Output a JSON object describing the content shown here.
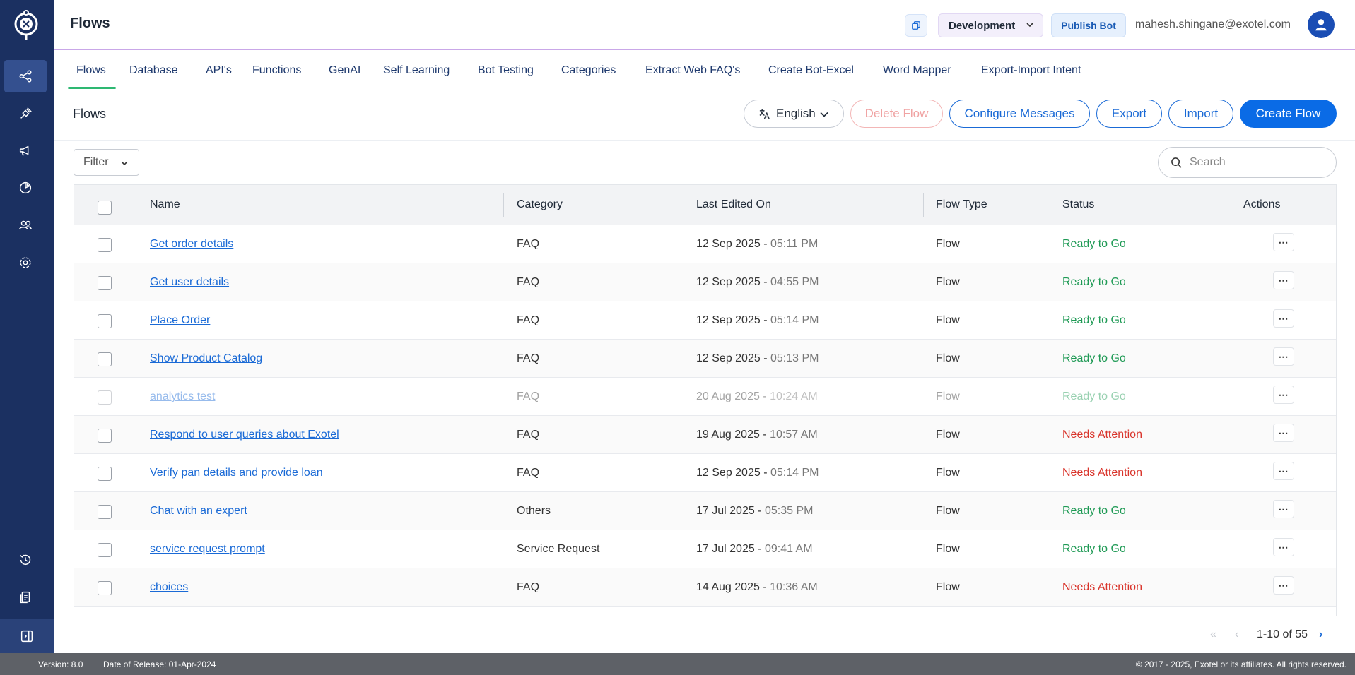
{
  "header": {
    "title": "Flows",
    "environment": "Development",
    "publish_label": "Publish Bot",
    "user_email": "mahesh.shingane@exotel.com"
  },
  "tabs": [
    {
      "label": "Flows"
    },
    {
      "label": "Database"
    },
    {
      "label": "API's"
    },
    {
      "label": "Functions"
    },
    {
      "label": "GenAI"
    },
    {
      "label": "Self Learning"
    },
    {
      "label": "Bot Testing"
    },
    {
      "label": "Categories"
    },
    {
      "label": "Extract Web FAQ's"
    },
    {
      "label": "Create Bot-Excel"
    },
    {
      "label": "Word Mapper"
    },
    {
      "label": "Export-Import Intent"
    }
  ],
  "toolbar": {
    "page_title": "Flows",
    "language": "English",
    "delete_label": "Delete Flow",
    "configure_label": "Configure Messages",
    "export_label": "Export",
    "import_label": "Import",
    "create_label": "Create Flow",
    "filter_label": "Filter",
    "search_placeholder": "Search"
  },
  "table": {
    "columns": [
      "Name",
      "Category",
      "Last Edited On",
      "Flow Type",
      "Status",
      "Actions"
    ],
    "rows": [
      {
        "name": "Get order details",
        "category": "FAQ",
        "date": "12 Sep 2025",
        "sep": " - ",
        "time": "05:11 PM",
        "type": "Flow",
        "status": "Ready to Go"
      },
      {
        "name": "Get user details",
        "category": "FAQ",
        "date": "12 Sep 2025",
        "sep": " - ",
        "time": "04:55 PM",
        "type": "Flow",
        "status": "Ready to Go"
      },
      {
        "name": "Place Order",
        "category": "FAQ",
        "date": "12 Sep 2025",
        "sep": " - ",
        "time": "05:14 PM",
        "type": "Flow",
        "status": "Ready to Go"
      },
      {
        "name": "Show Product Catalog",
        "category": "FAQ",
        "date": "12 Sep 2025",
        "sep": " - ",
        "time": "05:13 PM",
        "type": "Flow",
        "status": "Ready to Go"
      },
      {
        "name": "analytics test",
        "category": "FAQ",
        "date": "20 Aug 2025",
        "sep": " - ",
        "time": "10:24 AM",
        "type": "Flow",
        "status": "Ready to Go"
      },
      {
        "name": "Respond to user queries about Exotel",
        "category": "FAQ",
        "date": "19 Aug 2025",
        "sep": " - ",
        "time": "10:57 AM",
        "type": "Flow",
        "status": "Needs Attention"
      },
      {
        "name": "Verify pan details and provide loan",
        "category": "FAQ",
        "date": "12 Sep 2025",
        "sep": " - ",
        "time": "05:14 PM",
        "type": "Flow",
        "status": "Needs Attention"
      },
      {
        "name": "Chat with an expert",
        "category": "Others",
        "date": "17 Jul 2025",
        "sep": " - ",
        "time": "05:35 PM",
        "type": "Flow",
        "status": "Ready to Go"
      },
      {
        "name": "service request prompt",
        "category": "Service Request",
        "date": "17 Jul 2025",
        "sep": " - ",
        "time": "09:41 AM",
        "type": "Flow",
        "status": "Ready to Go"
      },
      {
        "name": "choices",
        "category": "FAQ",
        "date": "14 Aug 2025",
        "sep": " - ",
        "time": "10:36 AM",
        "type": "Flow",
        "status": "Needs Attention"
      }
    ],
    "actions_glyph": "⋯"
  },
  "pagination": {
    "range": "1-10 of 55"
  },
  "footer": {
    "version": "Version: 8.0",
    "release": "Date of Release: 01-Apr-2024",
    "copyright": "© 2017 - 2025, Exotel or its affiliates. All rights reserved."
  },
  "colors": {
    "sidebar": "#1b3061",
    "primary": "#0a6be6",
    "ready": "#1f9a55",
    "attention": "#d9342b",
    "tab_underline": "#2eb872"
  }
}
